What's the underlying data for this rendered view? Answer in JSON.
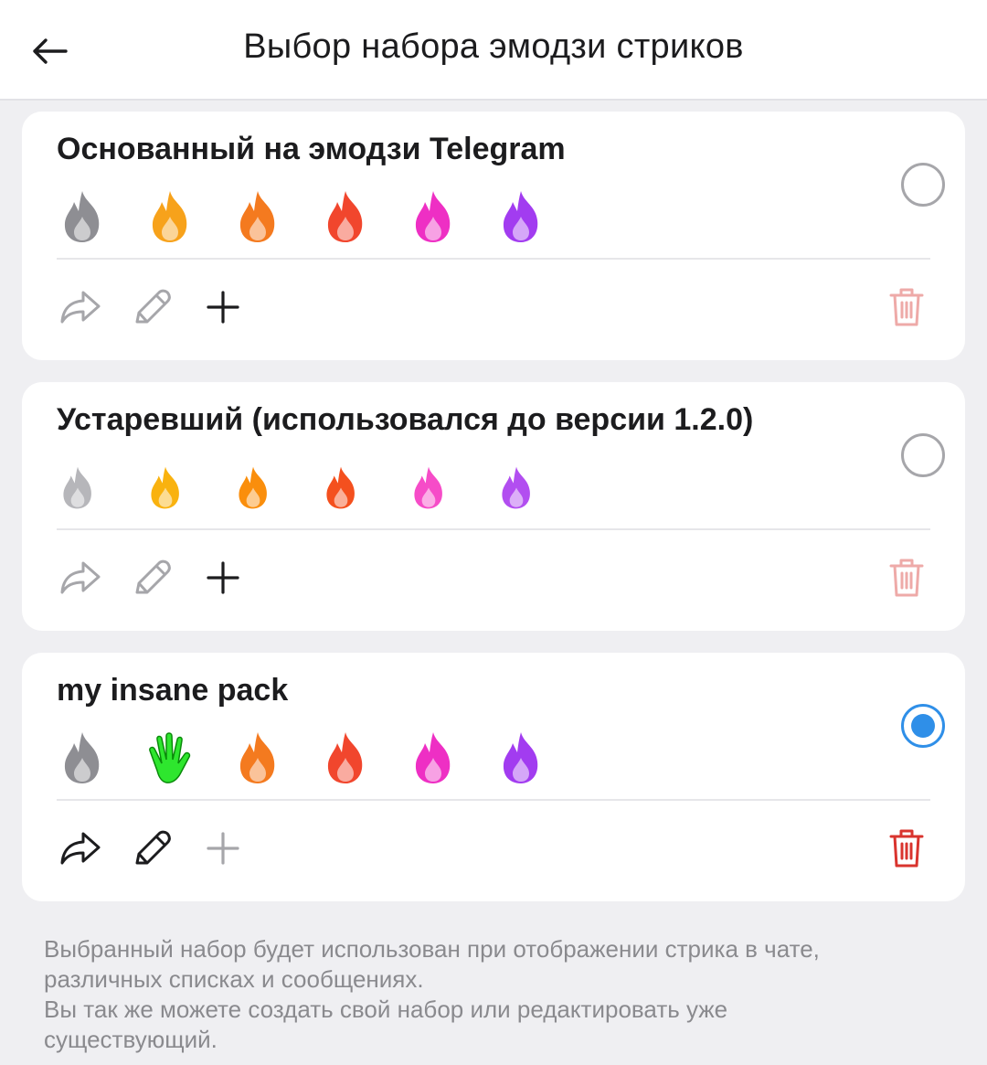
{
  "header": {
    "title": "Выбор набора эмодзи стриков",
    "back_icon": "arrow-left-icon"
  },
  "packs": [
    {
      "title": "Основанный на эмодзи Telegram",
      "selected": false,
      "actions_enabled": false,
      "emojis": [
        {
          "name": "fire-grey-emoji",
          "color": "#8e8e93"
        },
        {
          "name": "fire-yellow-emoji",
          "color": "#f7a21b"
        },
        {
          "name": "fire-orange-emoji",
          "color": "#f47a1f"
        },
        {
          "name": "fire-red-emoji",
          "color": "#f1462d"
        },
        {
          "name": "fire-pink-emoji",
          "color": "#ee2fc4"
        },
        {
          "name": "fire-purple-emoji",
          "color": "#a23cf0"
        }
      ]
    },
    {
      "title": "Устаревший (использовался до версии 1.2.0)",
      "selected": false,
      "actions_enabled": false,
      "emojis": [
        {
          "name": "fire-grey-emoji",
          "color": "#b6b6ba"
        },
        {
          "name": "fire-yellow-emoji",
          "color": "#f9b20f"
        },
        {
          "name": "fire-orange-emoji",
          "color": "#fa8e0c"
        },
        {
          "name": "fire-red-emoji",
          "color": "#f4501e"
        },
        {
          "name": "fire-pink-emoji",
          "color": "#f64cc8"
        },
        {
          "name": "fire-purple-emoji",
          "color": "#b24ef0"
        }
      ]
    },
    {
      "title": "my insane pack",
      "selected": true,
      "actions_enabled": true,
      "emojis": [
        {
          "name": "fire-grey-emoji",
          "color": "#8e8e93"
        },
        {
          "name": "waving-hand-green-emoji",
          "color": "#2ee62e"
        },
        {
          "name": "fire-orange-emoji",
          "color": "#f47a1f"
        },
        {
          "name": "fire-red-emoji",
          "color": "#f1462d"
        },
        {
          "name": "fire-pink-emoji",
          "color": "#ee2fc4"
        },
        {
          "name": "fire-purple-emoji",
          "color": "#a23cf0"
        }
      ]
    }
  ],
  "icons": {
    "share": "share-icon",
    "edit": "pencil-icon",
    "add": "plus-icon",
    "delete": "trash-icon"
  },
  "colors": {
    "accent": "#2f8fe8",
    "delete_enabled": "#d9342e",
    "delete_disabled": "#eeaaa8",
    "icon_enabled": "#1c1c1e",
    "icon_disabled": "#a6a6aa"
  },
  "footer": {
    "line1": "Выбранный набор будет использован при отображении стрика в чате,",
    "line2": "различных списках и сообщениях.",
    "line3": "Вы так же можете создать свой набор или редактировать уже",
    "line4": "существующий."
  }
}
